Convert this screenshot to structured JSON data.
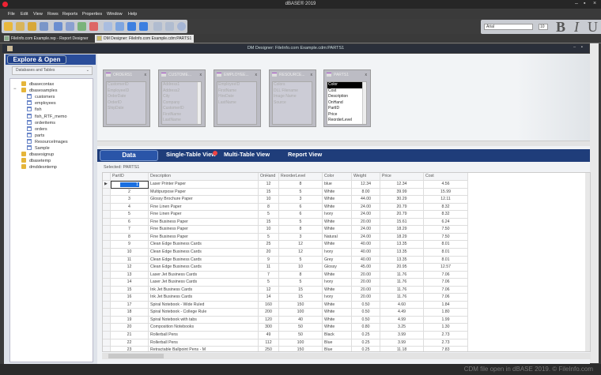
{
  "app": {
    "title": "dBASE® 2019"
  },
  "menu": [
    "File",
    "Edit",
    "View",
    "Rows",
    "Reports",
    "Properties",
    "Window",
    "Help"
  ],
  "font_toolbar": {
    "font": "Arial",
    "size": "10",
    "bold": "B",
    "italic": "I",
    "underline": "U"
  },
  "doc_tabs": [
    {
      "label": "FileInfo.com Example.rep - Report Designer"
    },
    {
      "label": "DM Designer: FileInfo.com Example.cdm:PARTS1"
    }
  ],
  "inner_window": {
    "title": "DM Designer: FileInfo.com Example.cdm:PARTS1"
  },
  "left": {
    "header": "Explore & Open",
    "select": "Databases and Tables",
    "tree": [
      {
        "label": "dbasecontax",
        "type": "db",
        "level": 0
      },
      {
        "label": "dbasesamples",
        "type": "db",
        "level": 0,
        "expanded": true
      },
      {
        "label": "customers",
        "type": "table",
        "level": 1
      },
      {
        "label": "employees",
        "type": "table",
        "level": 1
      },
      {
        "label": "fish",
        "type": "table",
        "level": 1
      },
      {
        "label": "fish_RTF_memo",
        "type": "table",
        "level": 1
      },
      {
        "label": "orderitems",
        "type": "table",
        "level": 1
      },
      {
        "label": "orders",
        "type": "table",
        "level": 1
      },
      {
        "label": "parts",
        "type": "table",
        "level": 1
      },
      {
        "label": "ResourceImages",
        "type": "table",
        "level": 1
      },
      {
        "label": "Sample",
        "type": "table",
        "level": 1
      },
      {
        "label": "dbasesignup",
        "type": "db",
        "level": 0
      },
      {
        "label": "dbasetemp",
        "type": "db",
        "level": 0
      },
      {
        "label": "dmddesntemp",
        "type": "db",
        "level": 0
      }
    ]
  },
  "tables": [
    {
      "title": "ORDERS1",
      "fields": [
        "CustomerID",
        "EmployeeID",
        "OrderDate",
        "OrderID",
        "ShipDate"
      ]
    },
    {
      "title": "CUSTOME...",
      "fields": [
        "Address1",
        "Address2",
        "City",
        "Company",
        "CustomerID",
        "FirstName",
        "LastName"
      ]
    },
    {
      "title": "EMPLOYEE...",
      "fields": [
        "EmployeeID",
        "FirstName",
        "HireDate",
        "LastName"
      ]
    },
    {
      "title": "RESOURCE...",
      "fields": [
        "Colors",
        "DLL Filename",
        "Image Name",
        "Source"
      ]
    },
    {
      "title": "PARTS1",
      "selected": true,
      "fields": [
        "Color",
        "Cost",
        "Description",
        "OnHand",
        "PartID",
        "Price",
        "ReorderLevel"
      ]
    }
  ],
  "view_tabs": [
    "Data",
    "Single-Table View",
    "Multi-Table View",
    "Report View"
  ],
  "selected_label": "Selected: PARTS1",
  "grid": {
    "columns": [
      "PartID",
      "Description",
      "OnHand",
      "ReorderLevel",
      "Color",
      "Weight",
      "Price",
      "Cost"
    ],
    "rows": [
      [
        "1",
        "Laser Printer Paper",
        "12",
        "8",
        "blue",
        "12.34",
        "12.34",
        "4.56"
      ],
      [
        "2",
        "Multipurpose Paper",
        "15",
        "5",
        "White",
        "8.00",
        "39.99",
        "15.99"
      ],
      [
        "3",
        "Glossy Brochure Paper",
        "10",
        "3",
        "White",
        "44.00",
        "30.29",
        "12.11"
      ],
      [
        "4",
        "Fine Linen Paper",
        "8",
        "6",
        "White",
        "24.00",
        "20.79",
        "8.32"
      ],
      [
        "5",
        "Fine Linen Paper",
        "5",
        "6",
        "Ivory",
        "24.00",
        "20.79",
        "8.32"
      ],
      [
        "6",
        "Fine Business Paper",
        "15",
        "5",
        "White",
        "20.00",
        "15.61",
        "6.24"
      ],
      [
        "7",
        "Fine Business Paper",
        "10",
        "8",
        "White",
        "24.00",
        "18.29",
        "7.50"
      ],
      [
        "8",
        "Fine Business Paper",
        "5",
        "3",
        "Natural",
        "24.00",
        "18.29",
        "7.50"
      ],
      [
        "9",
        "Clean Edge Business Cards",
        "25",
        "12",
        "White",
        "40.00",
        "13.35",
        "8.01"
      ],
      [
        "10",
        "Clean Edge Business Cards",
        "20",
        "12",
        "Ivory",
        "40.00",
        "13.35",
        "8.01"
      ],
      [
        "11",
        "Clean Edge Business Cards",
        "9",
        "5",
        "Grey",
        "40.00",
        "13.35",
        "8.01"
      ],
      [
        "12",
        "Clean Edge Business Cards",
        "11",
        "10",
        "Glossy",
        "45.00",
        "20.95",
        "12.57"
      ],
      [
        "13",
        "Laser Jet Business Cards",
        "7",
        "8",
        "White",
        "20.00",
        "11.76",
        "7.06"
      ],
      [
        "14",
        "Laser Jet Business Cards",
        "5",
        "5",
        "Ivory",
        "20.00",
        "11.76",
        "7.06"
      ],
      [
        "15",
        "Ink Jet Business Cards",
        "12",
        "15",
        "White",
        "20.00",
        "11.76",
        "7.06"
      ],
      [
        "16",
        "Ink Jet Business Cards",
        "14",
        "15",
        "Ivory",
        "20.00",
        "11.76",
        "7.06"
      ],
      [
        "17",
        "Spiral Notebook - Wide Ruled",
        "160",
        "150",
        "White",
        "0.50",
        "4.60",
        "1.84"
      ],
      [
        "18",
        "Spiral Notebook - College Rule",
        "200",
        "100",
        "White",
        "0.50",
        "4.49",
        "1.80"
      ],
      [
        "19",
        "Spiral Notebook with tabs",
        "120",
        "40",
        "White",
        "0.50",
        "4.99",
        "1.99"
      ],
      [
        "20",
        "Composition Notebooks",
        "300",
        "50",
        "White",
        "0.80",
        "3.25",
        "1.30"
      ],
      [
        "21",
        "Rollerball Pens",
        "49",
        "50",
        "Black",
        "0.25",
        "3.99",
        "2.73"
      ],
      [
        "22",
        "Rollerball Pens",
        "112",
        "100",
        "Blue",
        "0.25",
        "3.99",
        "2.73"
      ],
      [
        "23",
        "Retractable Ballpoint Pens - M",
        "250",
        "150",
        "Blue",
        "0.25",
        "11.18",
        "7.83"
      ]
    ]
  },
  "status": "CDM file open in dBASE 2019. © FileInfo.com"
}
